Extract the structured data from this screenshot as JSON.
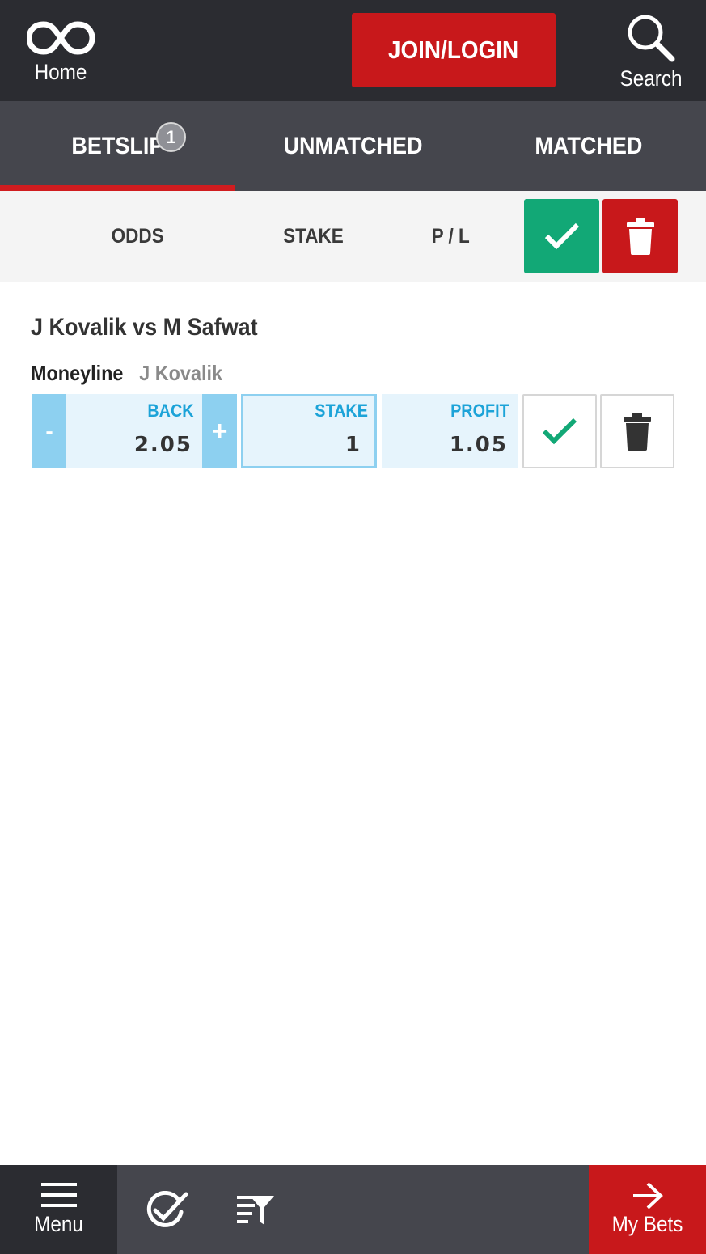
{
  "header": {
    "home_label": "Home",
    "join_login_label": "JOIN/LOGIN",
    "search_label": "Search"
  },
  "tabs": [
    {
      "label": "BETSLIP",
      "badge": "1",
      "active": true
    },
    {
      "label": "UNMATCHED",
      "active": false
    },
    {
      "label": "MATCHED",
      "active": false
    }
  ],
  "columns": {
    "odds": "ODDS",
    "stake": "STAKE",
    "pl": "P / L"
  },
  "bet": {
    "event": "J Kovalik vs M Safwat",
    "market": "Moneyline",
    "selection": "J Kovalik",
    "minus_label": "-",
    "plus_label": "+",
    "odds_label": "BACK",
    "odds_value": "2.05",
    "stake_label": "STAKE",
    "stake_value": "1",
    "profit_label": "PROFIT",
    "profit_value": "1.05"
  },
  "bottom_nav": {
    "menu_label": "Menu",
    "my_bets_label": "My Bets"
  },
  "colors": {
    "header_bg": "#2b2c31",
    "tab_bg": "#45464d",
    "accent_red": "#c8181b",
    "confirm_green": "#12a876",
    "back_blue": "#8dd0f0",
    "back_light": "#e6f4fc",
    "label_blue": "#1ca3d8"
  },
  "icons": [
    "infinity-logo-icon",
    "search-icon",
    "check-icon",
    "trash-icon",
    "hamburger-icon",
    "check-circle-icon",
    "filter-icon",
    "arrow-right-icon"
  ]
}
